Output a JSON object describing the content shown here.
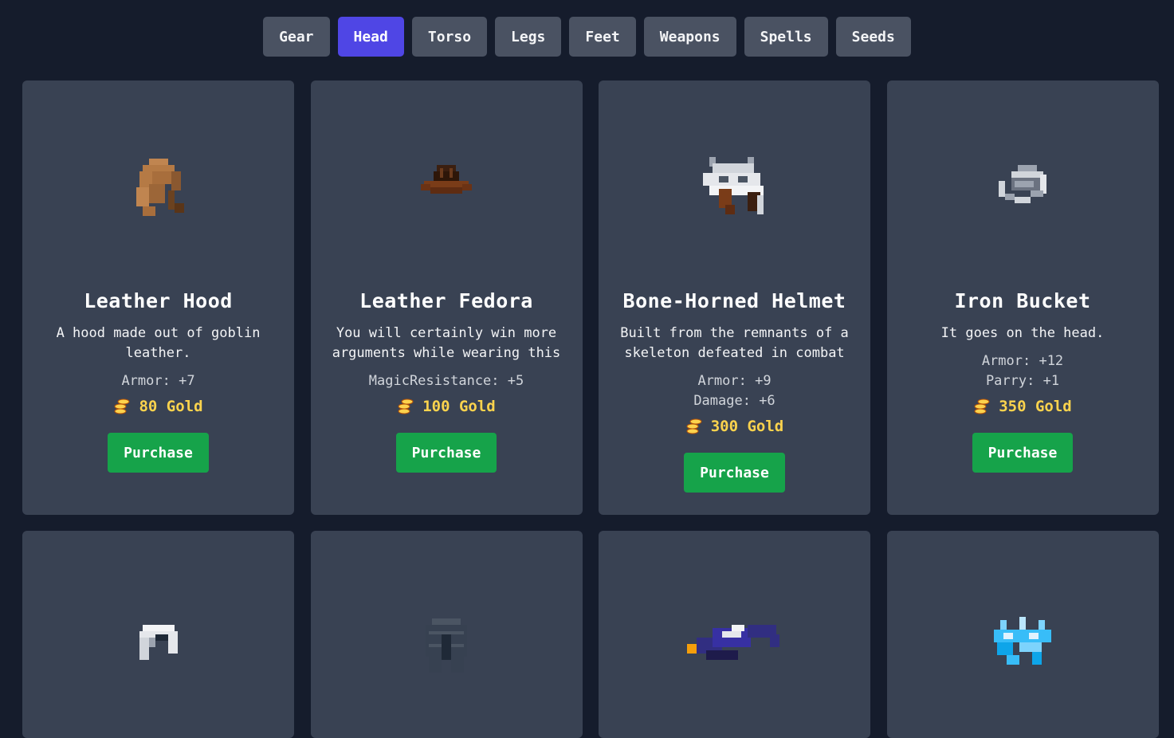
{
  "tabs": [
    "Gear",
    "Head",
    "Torso",
    "Legs",
    "Feet",
    "Weapons",
    "Spells",
    "Seeds"
  ],
  "active_tab": "Head",
  "items": [
    {
      "name": "Leather Hood",
      "desc": "A hood made out of goblin leather.",
      "stats": [
        "Armor: +7"
      ],
      "price": "80 Gold",
      "button": "Purchase",
      "icon": "leather-hood-icon"
    },
    {
      "name": "Leather Fedora",
      "desc": "You will certainly win more arguments while wearing this",
      "stats": [
        "MagicResistance: +5"
      ],
      "price": "100 Gold",
      "button": "Purchase",
      "icon": "leather-fedora-icon"
    },
    {
      "name": "Bone-Horned Helmet",
      "desc": "Built from the remnants of a skeleton defeated in combat",
      "stats": [
        "Armor: +9",
        "Damage: +6"
      ],
      "price": "300 Gold",
      "button": "Purchase",
      "icon": "bone-horned-helmet-icon"
    },
    {
      "name": "Iron Bucket",
      "desc": "It goes on the head.",
      "stats": [
        "Armor: +12",
        "Parry: +1"
      ],
      "price": "350 Gold",
      "button": "Purchase",
      "icon": "iron-bucket-icon"
    }
  ],
  "row2_icons": [
    "white-cap-icon",
    "dark-helmet-icon",
    "wizard-hat-icon",
    "ice-crown-icon"
  ],
  "colors": {
    "background": "#151c2c",
    "card": "#394253",
    "tab": "#4a5262",
    "active_tab": "#4f46e5",
    "button": "#16a34a",
    "gold": "#fcd34d"
  }
}
